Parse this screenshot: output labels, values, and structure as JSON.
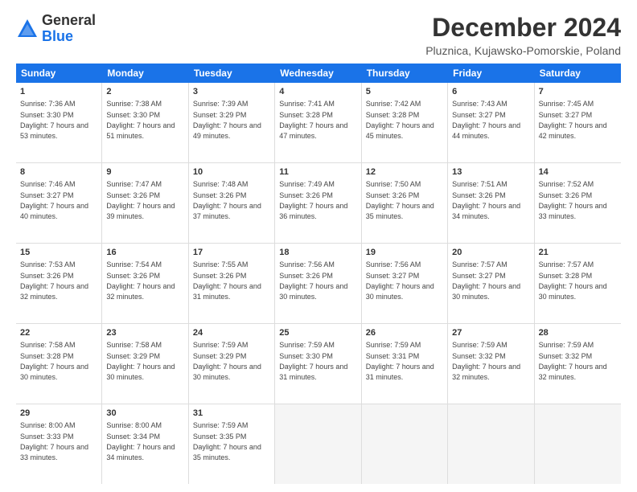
{
  "logo": {
    "general": "General",
    "blue": "Blue"
  },
  "title": "December 2024",
  "location": "Pluznica, Kujawsko-Pomorskie, Poland",
  "days": [
    "Sunday",
    "Monday",
    "Tuesday",
    "Wednesday",
    "Thursday",
    "Friday",
    "Saturday"
  ],
  "rows": [
    [
      {
        "day": "1",
        "sunrise": "7:36 AM",
        "sunset": "3:30 PM",
        "daylight": "7 hours and 53 minutes."
      },
      {
        "day": "2",
        "sunrise": "7:38 AM",
        "sunset": "3:30 PM",
        "daylight": "7 hours and 51 minutes."
      },
      {
        "day": "3",
        "sunrise": "7:39 AM",
        "sunset": "3:29 PM",
        "daylight": "7 hours and 49 minutes."
      },
      {
        "day": "4",
        "sunrise": "7:41 AM",
        "sunset": "3:28 PM",
        "daylight": "7 hours and 47 minutes."
      },
      {
        "day": "5",
        "sunrise": "7:42 AM",
        "sunset": "3:28 PM",
        "daylight": "7 hours and 45 minutes."
      },
      {
        "day": "6",
        "sunrise": "7:43 AM",
        "sunset": "3:27 PM",
        "daylight": "7 hours and 44 minutes."
      },
      {
        "day": "7",
        "sunrise": "7:45 AM",
        "sunset": "3:27 PM",
        "daylight": "7 hours and 42 minutes."
      }
    ],
    [
      {
        "day": "8",
        "sunrise": "7:46 AM",
        "sunset": "3:27 PM",
        "daylight": "7 hours and 40 minutes."
      },
      {
        "day": "9",
        "sunrise": "7:47 AM",
        "sunset": "3:26 PM",
        "daylight": "7 hours and 39 minutes."
      },
      {
        "day": "10",
        "sunrise": "7:48 AM",
        "sunset": "3:26 PM",
        "daylight": "7 hours and 37 minutes."
      },
      {
        "day": "11",
        "sunrise": "7:49 AM",
        "sunset": "3:26 PM",
        "daylight": "7 hours and 36 minutes."
      },
      {
        "day": "12",
        "sunrise": "7:50 AM",
        "sunset": "3:26 PM",
        "daylight": "7 hours and 35 minutes."
      },
      {
        "day": "13",
        "sunrise": "7:51 AM",
        "sunset": "3:26 PM",
        "daylight": "7 hours and 34 minutes."
      },
      {
        "day": "14",
        "sunrise": "7:52 AM",
        "sunset": "3:26 PM",
        "daylight": "7 hours and 33 minutes."
      }
    ],
    [
      {
        "day": "15",
        "sunrise": "7:53 AM",
        "sunset": "3:26 PM",
        "daylight": "7 hours and 32 minutes."
      },
      {
        "day": "16",
        "sunrise": "7:54 AM",
        "sunset": "3:26 PM",
        "daylight": "7 hours and 32 minutes."
      },
      {
        "day": "17",
        "sunrise": "7:55 AM",
        "sunset": "3:26 PM",
        "daylight": "7 hours and 31 minutes."
      },
      {
        "day": "18",
        "sunrise": "7:56 AM",
        "sunset": "3:26 PM",
        "daylight": "7 hours and 30 minutes."
      },
      {
        "day": "19",
        "sunrise": "7:56 AM",
        "sunset": "3:27 PM",
        "daylight": "7 hours and 30 minutes."
      },
      {
        "day": "20",
        "sunrise": "7:57 AM",
        "sunset": "3:27 PM",
        "daylight": "7 hours and 30 minutes."
      },
      {
        "day": "21",
        "sunrise": "7:57 AM",
        "sunset": "3:28 PM",
        "daylight": "7 hours and 30 minutes."
      }
    ],
    [
      {
        "day": "22",
        "sunrise": "7:58 AM",
        "sunset": "3:28 PM",
        "daylight": "7 hours and 30 minutes."
      },
      {
        "day": "23",
        "sunrise": "7:58 AM",
        "sunset": "3:29 PM",
        "daylight": "7 hours and 30 minutes."
      },
      {
        "day": "24",
        "sunrise": "7:59 AM",
        "sunset": "3:29 PM",
        "daylight": "7 hours and 30 minutes."
      },
      {
        "day": "25",
        "sunrise": "7:59 AM",
        "sunset": "3:30 PM",
        "daylight": "7 hours and 31 minutes."
      },
      {
        "day": "26",
        "sunrise": "7:59 AM",
        "sunset": "3:31 PM",
        "daylight": "7 hours and 31 minutes."
      },
      {
        "day": "27",
        "sunrise": "7:59 AM",
        "sunset": "3:32 PM",
        "daylight": "7 hours and 32 minutes."
      },
      {
        "day": "28",
        "sunrise": "7:59 AM",
        "sunset": "3:32 PM",
        "daylight": "7 hours and 32 minutes."
      }
    ],
    [
      {
        "day": "29",
        "sunrise": "8:00 AM",
        "sunset": "3:33 PM",
        "daylight": "7 hours and 33 minutes."
      },
      {
        "day": "30",
        "sunrise": "8:00 AM",
        "sunset": "3:34 PM",
        "daylight": "7 hours and 34 minutes."
      },
      {
        "day": "31",
        "sunrise": "7:59 AM",
        "sunset": "3:35 PM",
        "daylight": "7 hours and 35 minutes."
      },
      null,
      null,
      null,
      null
    ]
  ]
}
